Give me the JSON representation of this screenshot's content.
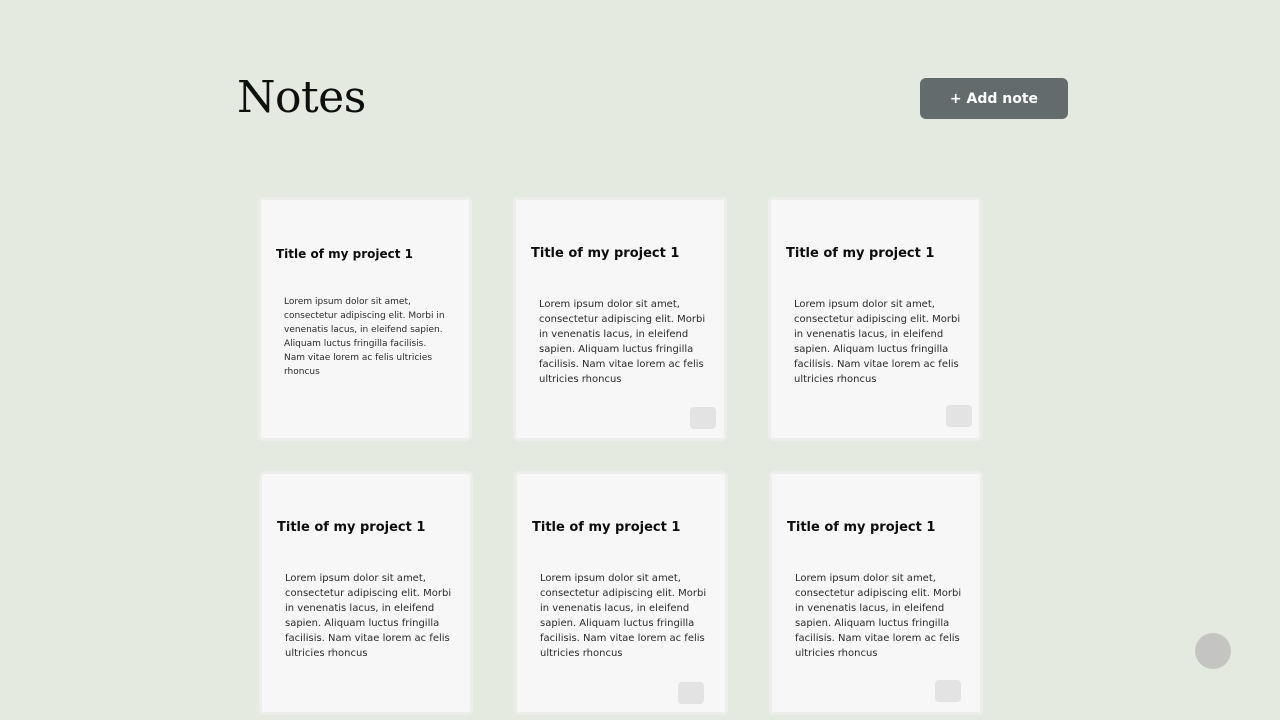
{
  "header": {
    "title": "Notes",
    "add_button_label": "+ Add note"
  },
  "notes": [
    {
      "title": "Title of my project 1",
      "body": "Lorem ipsum dolor sit amet, consectetur adipiscing elit. Morbi in venenatis lacus, in eleifend sapien. Aliquam luctus fringilla facilisis. Nam vitae lorem ac felis ultricies rhoncus"
    },
    {
      "title": "Title of my project 1",
      "body": "Lorem ipsum dolor sit amet, consectetur adipiscing elit. Morbi in venenatis lacus, in eleifend sapien. Aliquam luctus fringilla facilisis. Nam vitae lorem ac felis ultricies rhoncus"
    },
    {
      "title": "Title of my project 1",
      "body": "Lorem ipsum dolor sit amet, consectetur adipiscing elit. Morbi in venenatis lacus, in eleifend sapien. Aliquam luctus fringilla facilisis. Nam vitae lorem ac felis ultricies rhoncus"
    },
    {
      "title": "Title of my project 1",
      "body": "Lorem ipsum dolor sit amet, consectetur adipiscing elit. Morbi in venenatis lacus, in eleifend sapien. Aliquam luctus fringilla facilisis. Nam vitae lorem ac felis ultricies rhoncus"
    },
    {
      "title": "Title of my project 1",
      "body": "Lorem ipsum dolor sit amet, consectetur adipiscing elit. Morbi in venenatis lacus, in eleifend sapien. Aliquam luctus fringilla facilisis. Nam vitae lorem ac felis ultricies rhoncus"
    },
    {
      "title": "Title of my project 1",
      "body": "Lorem ipsum dolor sit amet, consectetur adipiscing elit. Morbi in venenatis lacus, in eleifend sapien. Aliquam luctus fringilla facilisis. Nam vitae lorem ac felis ultricies rhoncus"
    }
  ],
  "colors": {
    "background": "#e4eae0",
    "button": "#626c6c",
    "card": "#f7f7f7",
    "fab": "#c4c5c3"
  }
}
